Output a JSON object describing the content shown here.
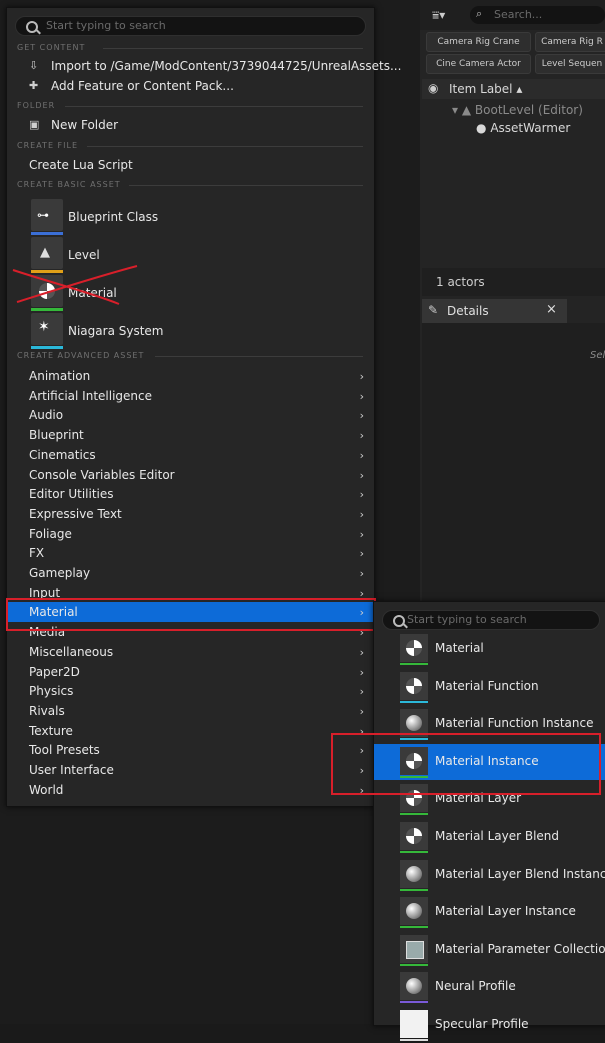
{
  "main_menu": {
    "search_placeholder": "Start typing to search",
    "sections": {
      "get_content": "GET CONTENT",
      "folder": "FOLDER",
      "create_file": "CREATE FILE",
      "create_basic": "CREATE BASIC ASSET",
      "create_advanced": "CREATE ADVANCED ASSET"
    },
    "import_label": "Import to /Game/ModContent/3739044725/UnrealAssets...",
    "add_feature_label": "Add Feature or Content Pack...",
    "new_folder_label": "New Folder",
    "create_lua_label": "Create Lua Script",
    "basic_assets": [
      {
        "label": "Blueprint Class",
        "icon": "blueprint-class-icon",
        "color": "#3b6fd6"
      },
      {
        "label": "Level",
        "icon": "level-icon",
        "color": "#e0a018"
      },
      {
        "label": "Material",
        "icon": "material-icon",
        "color": "#35b83a"
      },
      {
        "label": "Niagara System",
        "icon": "niagara-icon",
        "color": "#2bb8d9"
      }
    ],
    "advanced_categories": [
      "Animation",
      "Artificial Intelligence",
      "Audio",
      "Blueprint",
      "Cinematics",
      "Console Variables Editor",
      "Editor Utilities",
      "Expressive Text",
      "Foliage",
      "FX",
      "Gameplay",
      "Input",
      "Material",
      "Media",
      "Miscellaneous",
      "Paper2D",
      "Physics",
      "Rivals",
      "Texture",
      "Tool Presets",
      "User Interface",
      "World"
    ],
    "highlighted_category": "Material"
  },
  "submenu": {
    "search_placeholder": "Start typing to search",
    "items": [
      {
        "label": "Material",
        "color": "#35b83a"
      },
      {
        "label": "Material Function",
        "color": "#2bb8d9"
      },
      {
        "label": "Material Function Instance",
        "color": "#2bb8d9"
      },
      {
        "label": "Material Instance",
        "color": "#35b83a"
      },
      {
        "label": "Material Layer",
        "color": "#35b83a"
      },
      {
        "label": "Material Layer Blend",
        "color": "#35b83a"
      },
      {
        "label": "Material Layer Blend Instance",
        "color": "#35b83a"
      },
      {
        "label": "Material Layer Instance",
        "color": "#35b83a"
      },
      {
        "label": "Material Parameter Collection",
        "color": "#35b83a"
      },
      {
        "label": "Neural Profile",
        "color": "#7a5ad8"
      },
      {
        "label": "Specular Profile",
        "color": "#dddddd"
      }
    ],
    "highlighted_item": "Material Instance"
  },
  "outliner": {
    "search_placeholder": "Search...",
    "buttons": [
      "Camera Rig Crane",
      "Camera Rig R",
      "Cine Camera Actor",
      "Level Sequen"
    ],
    "column_label": "Item Label ▴",
    "tree": [
      {
        "label": "BootLevel (Editor)"
      },
      {
        "label": "AssetWarmer"
      }
    ],
    "actor_count": "1 actors"
  },
  "details": {
    "tab_label": "Details",
    "close": "×",
    "hint": "Sele"
  },
  "colors": {
    "highlight": "#0d6bd8",
    "annotation_red": "#d81f2a"
  }
}
